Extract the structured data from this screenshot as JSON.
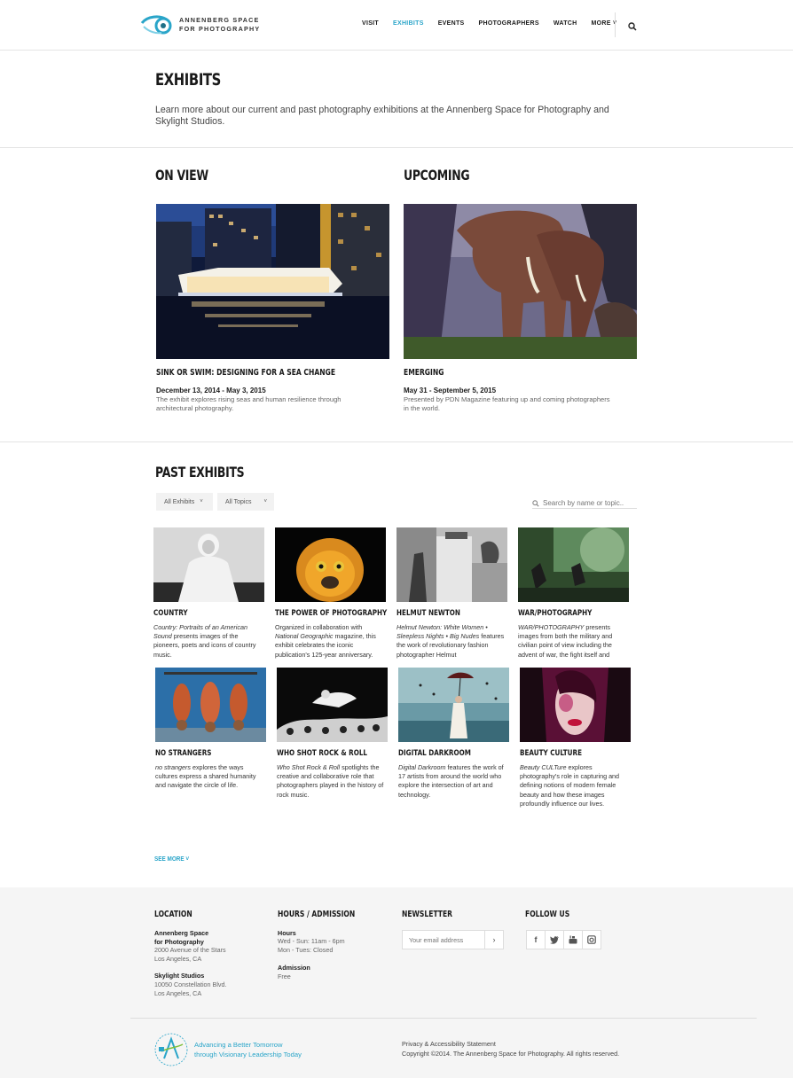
{
  "brand": {
    "line1": "ANNENBERG SPACE",
    "line2": "FOR PHOTOGRAPHY"
  },
  "nav": {
    "visit": "VISIT",
    "exhibits": "EXHIBITS",
    "events": "EVENTS",
    "photographers": "PHOTOGRAPHERS",
    "watch": "WATCH",
    "more": "MORE ˅"
  },
  "intro": {
    "title": "EXHIBITS",
    "text": "Learn more about our current and past photography exhibitions at the Annenberg Space for Photography and Skylight Studios."
  },
  "on_view": {
    "heading": "ON VIEW",
    "title": "SINK OR SWIM: DESIGNING FOR A SEA CHANGE",
    "date": "December 13, 2014 - May 3, 2015",
    "desc": "The exhibit explores rising seas and human resilience through architectural photography."
  },
  "upcoming": {
    "heading": "UPCOMING",
    "title": "EMERGING",
    "date": "May 31 - September 5, 2015",
    "desc": "Presented by PDN Magazine featuring up and coming photographers in the world."
  },
  "past": {
    "heading": "PAST EXHIBITS",
    "filter_exhibits": "All Exhibits",
    "filter_topics": "All Topics",
    "search_placeholder": "Search by name or topic..",
    "cards": [
      {
        "title": "COUNTRY",
        "em": "Country: Portraits of an American Sound",
        "desc": " presents images of the pioneers, poets and icons of country music."
      },
      {
        "title": "THE POWER OF PHOTOGRAPHY",
        "pre": "Organized in collaboration with ",
        "em": "National Geographic",
        "desc": " magazine, this exhibit celebrates the iconic publication's 125-year anniversary."
      },
      {
        "title": "HELMUT NEWTON",
        "em": "Helmut Newton: White Women • Sleepless Nights • Big Nudes",
        "desc": " features the work of revolutionary fashion photographer Helmut"
      },
      {
        "title": "WAR/PHOTOGRAPHY",
        "em": "WAR/PHOTOGRAPHY",
        "desc": " presents images from both the military and civilian point of view including the advent of war, the fight itself and"
      },
      {
        "title": "NO STRANGERS",
        "em": "no strangers",
        "desc": " explores the ways cultures express a shared humanity and navigate the circle of life."
      },
      {
        "title": "WHO SHOT ROCK & ROLL",
        "em": "Who Shot Rock & Roll",
        "desc": " spotlights the creative and collaborative role that photographers played in the history of rock music."
      },
      {
        "title": "DIGITAL DARKROOM",
        "em": "Digital Darkroom",
        "desc": " features the work of 17 artists from around the world who explore the intersection of art and technology."
      },
      {
        "title": "BEAUTY CULTURE",
        "em": "Beauty CULTure",
        "desc": " explores photography's role in capturing and defining notions of modern female beauty and how these images profoundly influence our lives."
      }
    ],
    "see_more": "SEE MORE ˅"
  },
  "footer": {
    "location_h": "LOCATION",
    "loc1_name1": "Annenberg Space",
    "loc1_name2": "for Photography",
    "loc1_addr1": "2000 Avenue of the Stars",
    "loc1_addr2": "Los Angeles, CA",
    "loc2_name": "Skylight Studios",
    "loc2_addr1": "10050 Constellation Blvd.",
    "loc2_addr2": "Los Angeles, CA",
    "hours_h": "HOURS / ADMISSION",
    "hours_label": "Hours",
    "hours1": "Wed - Sun: 11am - 6pm",
    "hours2": "Mon - Tues: Closed",
    "admission_label": "Admission",
    "admission": "Free",
    "newsletter_h": "NEWSLETTER",
    "email_placeholder": "Your email address",
    "follow_h": "FOLLOW US",
    "tagline1": "Advancing a Better Tomorrow",
    "tagline2": "through Visionary Leadership Today",
    "privacy": "Privacy & Accessibility Statement",
    "copyright": "Copyright ©2014. The Annenberg Space for Photography. All rights reserved."
  },
  "colors": {
    "accent": "#2aa5c9",
    "footer_bg": "#f5f5f5"
  }
}
